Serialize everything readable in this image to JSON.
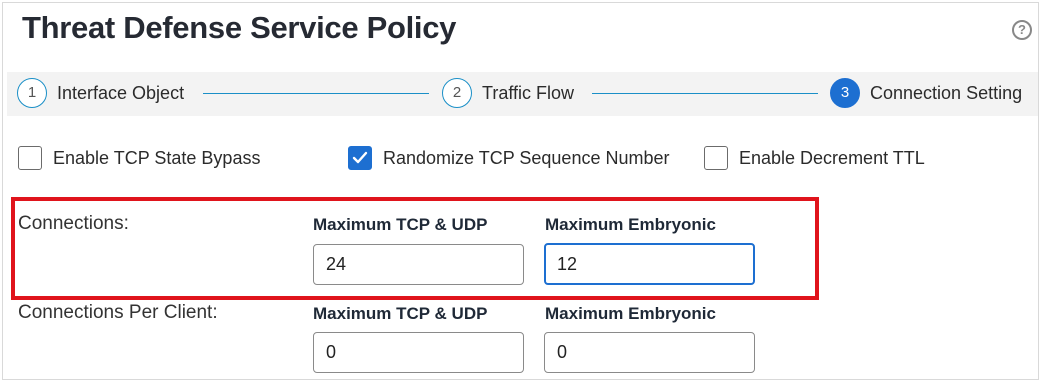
{
  "header": {
    "title": "Threat Defense Service Policy",
    "help_icon": "question-circle-icon"
  },
  "stepper": {
    "steps": [
      {
        "number": "1",
        "label": "Interface Object"
      },
      {
        "number": "2",
        "label": "Traffic Flow"
      },
      {
        "number": "3",
        "label": "Connection Setting",
        "active": true
      }
    ]
  },
  "options": {
    "tcp_state_bypass": {
      "label": "Enable TCP State Bypass",
      "checked": false
    },
    "randomize_tcp_seq": {
      "label": "Randomize TCP Sequence Number",
      "checked": true
    },
    "decrement_ttl": {
      "label": "Enable Decrement TTL",
      "checked": false
    }
  },
  "connections": {
    "label": "Connections:",
    "max_tcp_udp": {
      "label": "Maximum TCP & UDP",
      "value": "24"
    },
    "max_embryonic": {
      "label": "Maximum Embryonic",
      "value": "12"
    }
  },
  "connections_per_client": {
    "label": "Connections Per Client:",
    "max_tcp_udp": {
      "label": "Maximum TCP & UDP",
      "value": "0"
    },
    "max_embryonic": {
      "label": "Maximum Embryonic",
      "value": "0"
    }
  },
  "colors": {
    "accent": "#1d6fd1",
    "step_line": "#1a8fc7",
    "highlight": "#e0141c"
  }
}
